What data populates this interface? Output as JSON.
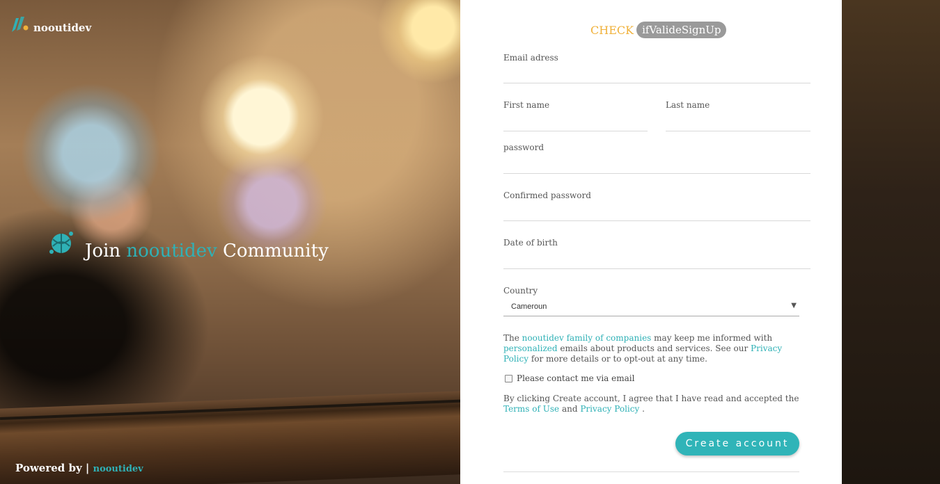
{
  "brand": {
    "name": "nooutidev",
    "accent": "#2fb1b6",
    "check_color": "#f0b13a"
  },
  "hero": {
    "join_prefix": "Join",
    "join_brand": "nooutidev",
    "join_suffix": "Community",
    "powered_by": "Powered by |",
    "powered_brand": "nooutidev"
  },
  "form": {
    "check_label": "CHECK",
    "check_badge": "ifValideSignUp",
    "email_label": "Email adress",
    "first_name_label": "First name",
    "last_name_label": "Last name",
    "password_label": "password",
    "confirm_password_label": "Confirmed password",
    "dob_label": "Date of birth",
    "country_label": "Country",
    "country_value": "Cameroun",
    "info": {
      "t1": "The",
      "link1": "nooutidev family of companies",
      "t2": "may keep me informed with",
      "link2": "personalized",
      "t3": "emails about products and services. See our",
      "link3": "Privacy Policy",
      "t4": "for more details or to opt-out at any time."
    },
    "contact_label": "Please contact me via email",
    "terms": {
      "t1": "By clicking Create account, I agree that I have read and accepted the",
      "link1": "Terms of Use",
      "t2": "and",
      "link2": "Privacy Policy",
      "t3": "."
    },
    "create_button": "Create account"
  }
}
